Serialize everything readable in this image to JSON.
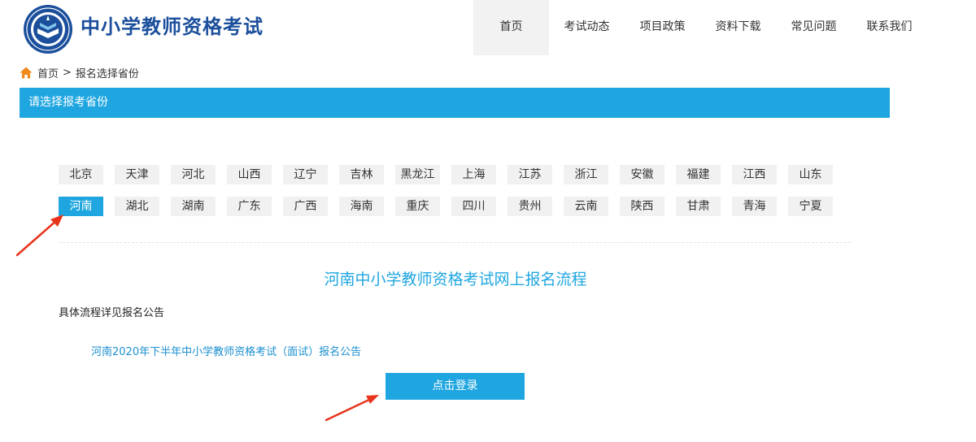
{
  "header": {
    "site_title": "中小学教师资格考试",
    "logo_icon": "emblem-logo",
    "nav": [
      {
        "label": "首页",
        "active": true
      },
      {
        "label": "考试动态",
        "active": false
      },
      {
        "label": "项目政策",
        "active": false
      },
      {
        "label": "资料下载",
        "active": false
      },
      {
        "label": "常见问题",
        "active": false
      },
      {
        "label": "联系我们",
        "active": false
      }
    ]
  },
  "breadcrumb": {
    "home_icon": "home-icon",
    "home": "首页",
    "separator": ">",
    "current": "报名选择省份"
  },
  "section": {
    "title": "请选择报考省份"
  },
  "provinces": {
    "selected": "河南",
    "row1": [
      "北京",
      "天津",
      "河北",
      "山西",
      "辽宁",
      "吉林",
      "黑龙江",
      "上海",
      "江苏",
      "浙江",
      "安徽",
      "福建",
      "江西",
      "山东"
    ],
    "row2": [
      "河南",
      "湖北",
      "湖南",
      "广东",
      "广西",
      "海南",
      "重庆",
      "四川",
      "贵州",
      "云南",
      "陕西",
      "甘肃",
      "青海",
      "宁夏"
    ]
  },
  "process": {
    "title": "河南中小学教师资格考试网上报名流程",
    "note": "具体流程详见报名公告",
    "notice_link": "河南2020年下半年中小学教师资格考试（面试）报名公告",
    "login_button": "点击登录"
  },
  "colors": {
    "brand_blue": "#1fa6e0",
    "title_blue": "#1b4f9c",
    "arrow_red": "#e8341c",
    "home_orange": "#f08a1c"
  }
}
